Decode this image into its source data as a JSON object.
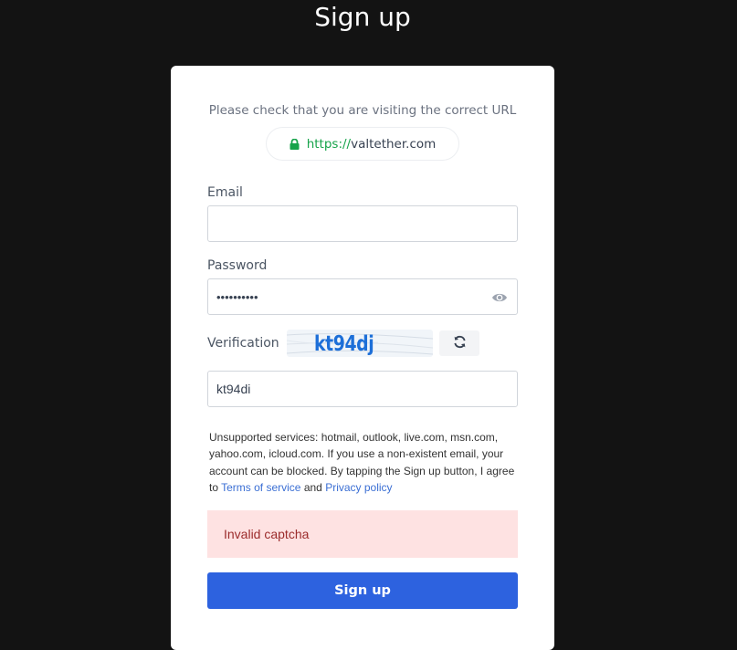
{
  "page": {
    "title": "Sign up"
  },
  "url_check": {
    "note": "Please check that you are visiting the correct URL",
    "protocol": "https://",
    "domain": "valtether.com",
    "icon": "lock-icon",
    "accent_color": "#16a34a"
  },
  "form": {
    "email": {
      "label": "Email",
      "value": "",
      "placeholder": ""
    },
    "password": {
      "label": "Password",
      "masked_value": "••••••••••",
      "toggle_icon": "eye-icon"
    },
    "verification": {
      "label": "Verification",
      "captcha_image_text": "kt94dj",
      "refresh_icon": "refresh-icon",
      "value": "kt94di"
    },
    "disclaimer": {
      "text_before": "Unsupported services: hotmail, outlook, live.com, msn.com, yahoo.com, icloud.com. If you use a non-existent email, your account can be blocked. By tapping the Sign up button, I agree to ",
      "terms_link": "Terms of service",
      "and": " and ",
      "privacy_link": "Privacy policy"
    },
    "error": {
      "message": "Invalid captcha",
      "background": "#fee2e2",
      "color": "#9b2c2c"
    },
    "submit_label": "Sign up",
    "submit_color": "#2d62df"
  }
}
